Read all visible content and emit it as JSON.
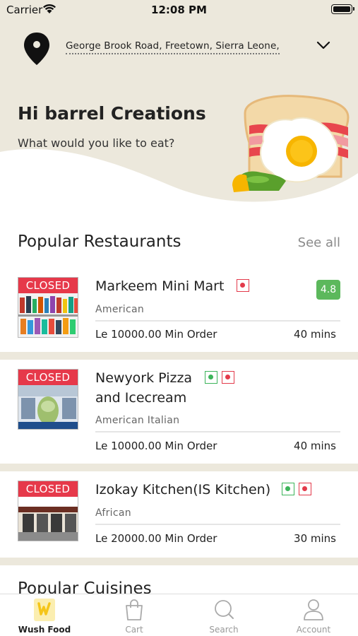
{
  "status_bar": {
    "carrier": "Carrier",
    "time": "12:08 PM"
  },
  "header": {
    "address": "George Brook Road, Freetown, Sierra Leone,",
    "greeting": "Hi barrel Creations",
    "subtitle": "What would you like to eat?"
  },
  "popular_restaurants": {
    "title": "Popular Restaurants",
    "see_all": "See all",
    "items": [
      {
        "status": "CLOSED",
        "name_line1": "Markeem Mini Mart",
        "name_line2": "",
        "cuisine": "American",
        "min_order": "Le 10000.00 Min Order",
        "time": "40 mins",
        "rating": "4.8",
        "veg": false,
        "nonveg": true
      },
      {
        "status": "CLOSED",
        "name_line1": "Newyork Pizza",
        "name_line2": "and Icecream",
        "cuisine": "American  Italian",
        "min_order": "Le 10000.00 Min Order",
        "time": "40 mins",
        "rating": "",
        "veg": true,
        "nonveg": true
      },
      {
        "status": "CLOSED",
        "name_line1": "Izokay Kitchen(IS Kitchen)",
        "name_line2": "",
        "cuisine": "African",
        "min_order": "Le 20000.00 Min Order",
        "time": "30 mins",
        "rating": "",
        "veg": true,
        "nonveg": true
      }
    ]
  },
  "popular_cuisines": {
    "title": "Popular Cuisines"
  },
  "tabs": [
    {
      "label": "Wush Food",
      "icon": "wush-logo-icon",
      "active": true
    },
    {
      "label": "Cart",
      "icon": "bag-icon",
      "active": false
    },
    {
      "label": "Search",
      "icon": "search-icon",
      "active": false
    },
    {
      "label": "Account",
      "icon": "person-icon",
      "active": false
    }
  ],
  "colors": {
    "accent": "#e6394a",
    "rating": "#5cb85c",
    "hero_bg": "#ece8dc",
    "brand": "#f5c518"
  }
}
